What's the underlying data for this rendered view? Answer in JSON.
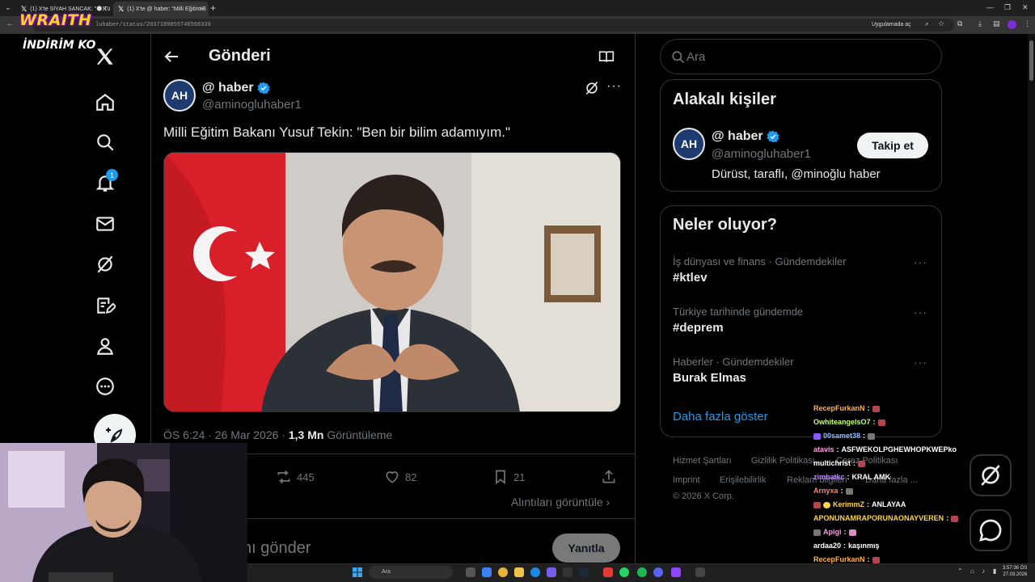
{
  "browser": {
    "tabs": [
      {
        "title": "(1) X'te SİYAH SANCAK: \"🌑 Tü"
      },
      {
        "title": "(1) X'te @ haber: \"Milli Eğitim B"
      }
    ],
    "url": "luhaber/status/2037189055746568339",
    "app_chip": "Uygulamada aç"
  },
  "overlay": {
    "brand": "WRAITH",
    "brand_sub": "İNDİRİM KO"
  },
  "nav": {
    "notification_count": "1",
    "items": [
      "home-icon",
      "search-icon",
      "bell-icon",
      "mail-icon",
      "grok-icon",
      "compose-list-icon",
      "profile-icon",
      "more-circle-icon"
    ]
  },
  "header": {
    "title": "Gönderi"
  },
  "tweet": {
    "avatar_text": "AH",
    "name": "@ haber",
    "handle": "@aminogluhaber1",
    "text": "Milli Eğitim Bakanı Yusuf Tekin: \"Ben bir bilim adamıyım.\"",
    "time": "ÖS 6:24 · 26 Mar 2026 · ",
    "views": "1,3 Mn",
    "views_label": " Görüntüleme",
    "retweets": "445",
    "likes": "82",
    "bookmarks": "21",
    "quotes_link": "Alıntıları görüntüle ›",
    "reply_placeholder": "nı gönder",
    "reply_button": "Yanıtla"
  },
  "search": {
    "placeholder": "Ara"
  },
  "related": {
    "title": "Alakalı kişiler",
    "avatar_text": "AH",
    "name": "@ haber",
    "handle": "@aminogluhaber1",
    "bio": "Dürüst, taraflı, @minoğlu haber",
    "follow": "Takip et"
  },
  "trends": {
    "title": "Neler oluyor?",
    "items": [
      {
        "meta": "İş dünyası ve finans · Gündemdekiler",
        "name": "#ktlev"
      },
      {
        "meta": "Türkiye tarihinde gündemde",
        "name": "#deprem"
      },
      {
        "meta": "Haberler · Gündemdekiler",
        "name": "Burak Elmas"
      }
    ],
    "show_more": "Daha fazla göster"
  },
  "footer": {
    "links": [
      "Hizmet Şartları",
      "Gizlilik Politikası",
      "Çerez Politikası",
      "Imprint",
      "Erişilebilirlik",
      "Reklam bilgileri",
      "Daha fazla ..."
    ],
    "copyright": "© 2026 X Corp."
  },
  "chat": [
    {
      "user": "RecepFurkanN",
      "color": "#ffb347",
      "msg": ""
    },
    {
      "user": "OwhiteangelsO7",
      "color": "#c8ff6b",
      "msg": ""
    },
    {
      "user": "00samet38",
      "color": "#8fb8ff",
      "msg": ""
    },
    {
      "user": "atavis",
      "color": "#ff9de2",
      "msg": "ASFWEKOLPGHEWHOPKWEPko"
    },
    {
      "user": "multichrist",
      "color": "#ffffff",
      "msg": ""
    },
    {
      "user": "zimbatkc",
      "color": "#b889ff",
      "msg": "KRAL AMK"
    },
    {
      "user": "Arnyxa",
      "color": "#ff7f7f",
      "msg": ""
    },
    {
      "user": "KerimmZ",
      "color": "#ffd54a",
      "msg": "ANLAYAA"
    },
    {
      "user": "APONUNAMRAPORUNAONAYVEREN",
      "color": "#ffd54a",
      "msg": ""
    },
    {
      "user": "Apigi",
      "color": "#ff9de2",
      "msg": ""
    },
    {
      "user": "ardaa20",
      "color": "#ffffff",
      "msg": "kaşınmış"
    },
    {
      "user": "RecepFurkanN",
      "color": "#ffb347",
      "msg": ""
    }
  ],
  "taskbar": {
    "search": "Ara",
    "time": "3:57:36 ÖS",
    "date": "27.03.2026"
  },
  "colors": {
    "accent": "#1d9bf0",
    "background": "#000000",
    "border": "#2f3336",
    "muted": "#71767b"
  }
}
